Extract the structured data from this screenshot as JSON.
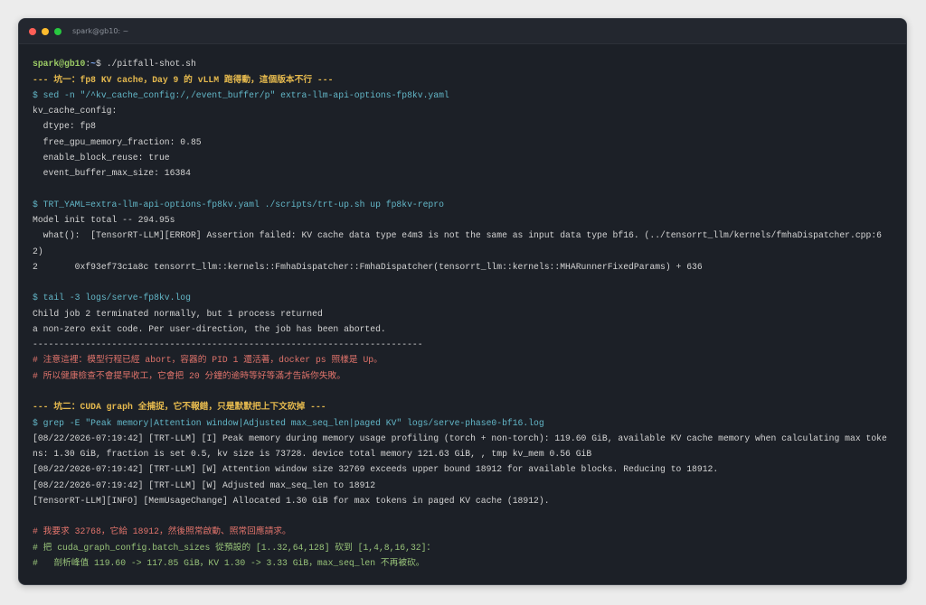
{
  "window": {
    "title": "spark@gb10: ~"
  },
  "theme": {
    "window_bg": "#1c2027",
    "titlebar_bg": "#23272f",
    "title_text": "#8b9099",
    "text": "#d4d4d4",
    "prompt_user": "#9ccc65",
    "prompt_cwd": "#7aa6f0",
    "close": "#ff5f57",
    "minimize": "#febc2e",
    "maximize": "#28c840"
  },
  "terminal": {
    "prompt": {
      "user_host": "spark@gb10",
      "separator": ":",
      "cwd": "~",
      "symbol": "$",
      "command": "./pitfall-shot.sh"
    },
    "lines": [
      {
        "text": "--- 坑一：fp8 KV cache，Day 9 的 vLLM 跑得動，這個版本不行 ---",
        "color": "#e5b94e",
        "bold": true
      },
      {
        "text": "$ sed -n \"/^kv_cache_config:/,/event_buffer/p\" extra-llm-api-options-fp8kv.yaml",
        "color": "#63b7c8",
        "bold": false
      },
      {
        "text": "kv_cache_config:",
        "color": "#d4d4d4",
        "bold": false
      },
      {
        "text": "  dtype: fp8",
        "color": "#d4d4d4",
        "bold": false
      },
      {
        "text": "  free_gpu_memory_fraction: 0.85",
        "color": "#d4d4d4",
        "bold": false
      },
      {
        "text": "  enable_block_reuse: true",
        "color": "#d4d4d4",
        "bold": false
      },
      {
        "text": "  event_buffer_max_size: 16384",
        "color": "#d4d4d4",
        "bold": false
      },
      {
        "text": "",
        "color": "#d4d4d4",
        "bold": false
      },
      {
        "text": "$ TRT_YAML=extra-llm-api-options-fp8kv.yaml ./scripts/trt-up.sh up fp8kv-repro",
        "color": "#63b7c8",
        "bold": false
      },
      {
        "text": "Model init total -- 294.95s",
        "color": "#d4d4d4",
        "bold": false
      },
      {
        "text": "  what():  [TensorRT-LLM][ERROR] Assertion failed: KV cache data type e4m3 is not the same as input data type bf16. (../tensorrt_llm/kernels/fmhaDispatcher.cpp:6",
        "color": "#d4d4d4",
        "bold": false
      },
      {
        "text": "2)",
        "color": "#d4d4d4",
        "bold": false
      },
      {
        "text": "2       0xf93ef73c1a8c tensorrt_llm::kernels::FmhaDispatcher::FmhaDispatcher(tensorrt_llm::kernels::MHARunnerFixedParams) + 636",
        "color": "#d4d4d4",
        "bold": false
      },
      {
        "text": "",
        "color": "#d4d4d4",
        "bold": false
      },
      {
        "text": "$ tail -3 logs/serve-fp8kv.log",
        "color": "#63b7c8",
        "bold": false
      },
      {
        "text": "Child job 2 terminated normally, but 1 process returned",
        "color": "#d4d4d4",
        "bold": false
      },
      {
        "text": "a non-zero exit code. Per user-direction, the job has been aborted.",
        "color": "#d4d4d4",
        "bold": false
      },
      {
        "text": "--------------------------------------------------------------------------",
        "color": "#d4d4d4",
        "bold": false
      },
      {
        "text": "# 注意這裡：模型行程已經 abort，容器的 PID 1 還活著，docker ps 照樣是 Up。",
        "color": "#e0736b",
        "bold": false
      },
      {
        "text": "# 所以健康檢查不會提早收工，它會把 20 分鐘的逾時等好等滿才告訴你失敗。",
        "color": "#e0736b",
        "bold": false
      },
      {
        "text": "",
        "color": "#d4d4d4",
        "bold": false
      },
      {
        "text": "--- 坑二：CUDA graph 全捕捉，它不報錯，只是默默把上下文砍掉 ---",
        "color": "#e5b94e",
        "bold": true
      },
      {
        "text": "$ grep -E \"Peak memory|Attention window|Adjusted max_seq_len|paged KV\" logs/serve-phase0-bf16.log",
        "color": "#63b7c8",
        "bold": false
      },
      {
        "text": "[08/22/2026-07:19:42] [TRT-LLM] [I] Peak memory during memory usage profiling (torch + non-torch): 119.60 GiB, available KV cache memory when calculating max toke",
        "color": "#d4d4d4",
        "bold": false
      },
      {
        "text": "ns: 1.30 GiB, fraction is set 0.5, kv size is 73728. device total memory 121.63 GiB, , tmp kv_mem 0.56 GiB",
        "color": "#d4d4d4",
        "bold": false
      },
      {
        "text": "[08/22/2026-07:19:42] [TRT-LLM] [W] Attention window size 32769 exceeds upper bound 18912 for available blocks. Reducing to 18912.",
        "color": "#d4d4d4",
        "bold": false
      },
      {
        "text": "[08/22/2026-07:19:42] [TRT-LLM] [W] Adjusted max_seq_len to 18912",
        "color": "#d4d4d4",
        "bold": false
      },
      {
        "text": "[TensorRT-LLM][INFO] [MemUsageChange] Allocated 1.30 GiB for max tokens in paged KV cache (18912).",
        "color": "#d4d4d4",
        "bold": false
      },
      {
        "text": "",
        "color": "#d4d4d4",
        "bold": false
      },
      {
        "text": "# 我要求 32768，它給 18912，然後照常啟動、照常回應請求。",
        "color": "#e0736b",
        "bold": false
      },
      {
        "text": "# 把 cuda_graph_config.batch_sizes 從預設的 [1..32,64,128] 砍到 [1,4,8,16,32]：",
        "color": "#98c379",
        "bold": false
      },
      {
        "text": "#   剖析峰值 119.60 -> 117.85 GiB，KV 1.30 -> 3.33 GiB，max_seq_len 不再被砍。",
        "color": "#98c379",
        "bold": false
      }
    ]
  }
}
